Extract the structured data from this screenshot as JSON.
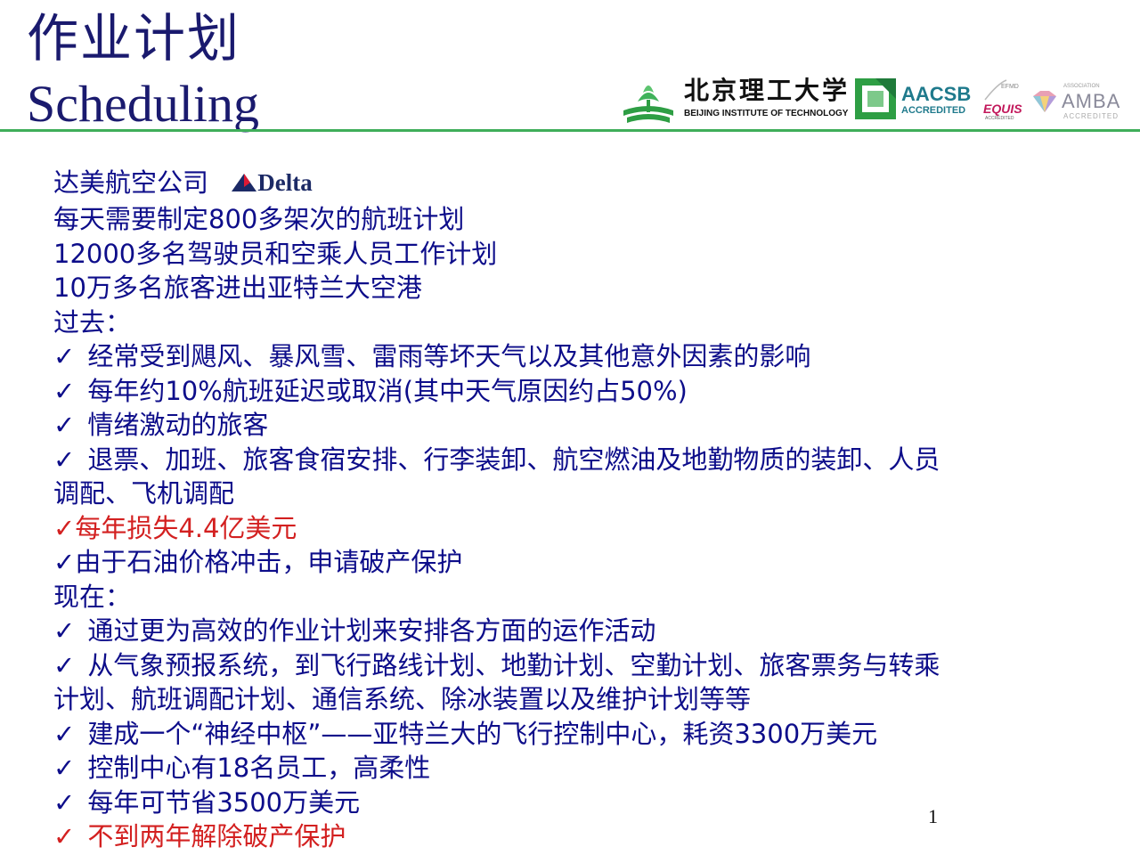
{
  "slide": {
    "title_cn": "作业计划",
    "title_en": "Scheduling",
    "page_number": "1"
  },
  "logos": {
    "bit_cn": "北京理工大学",
    "bit_en": "BEIJING INSTITUTE OF TECHNOLOGY",
    "aacsb_main": "AACSB",
    "aacsb_sub": "ACCREDITED",
    "equis_top": "EFMD",
    "equis_main": "EQUIS",
    "equis_sub": "ACCREDITED",
    "amba_assoc": "ASSOCIATION",
    "amba_main": "AMBA",
    "amba_sub": "ACCREDITED"
  },
  "content": {
    "company": "达美航空公司",
    "delta_label": "Delta",
    "check_mark": "✓",
    "lines": [
      "每天需要制定800多架次的航班计划",
      "12000多名驾驶员和空乘人员工作计划",
      "10万多名旅客进出亚特兰大空港"
    ],
    "past_heading": "过去：",
    "past_items": [
      "经常受到飓风、暴风雪、雷雨等坏天气以及其他意外因素的影响",
      "每年约10%航班延迟或取消(其中天气原因约占50%)",
      "情绪激动的旅客",
      "退票、加班、旅客食宿安排、行李装卸、航空燃油及地勤物质的装卸、人员",
      "调配、飞机调配"
    ],
    "past_loss": "每年损失4.4亿美元",
    "past_bankruptcy": "由于石油价格冲击，申请破产保护",
    "now_heading": "现在：",
    "now_items": [
      "通过更为高效的作业计划来安排各方面的运作活动",
      "从气象预报系统，到飞行路线计划、地勤计划、空勤计划、旅客票务与转乘",
      "计划、航班调配计划、通信系统、除冰装置以及维护计划等等",
      "建成一个“神经中枢”——亚特兰大的飞行控制中心，耗资3300万美元",
      "控制中心有18名员工，高柔性",
      "每年可节省3500万美元"
    ],
    "now_result": "不到两年解除破产保护"
  }
}
